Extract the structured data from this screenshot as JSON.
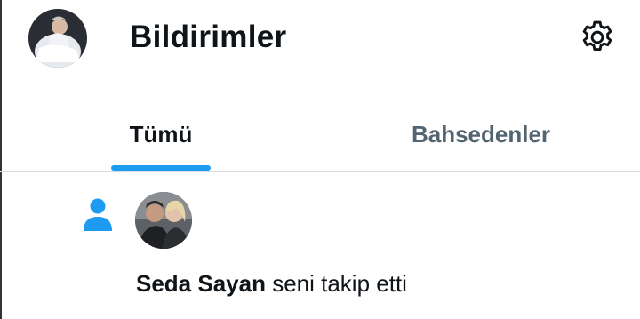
{
  "header": {
    "title": "Bildirimler",
    "avatar_icon": "user-avatar",
    "settings_icon": "gear-icon"
  },
  "tabs": [
    {
      "label": "Tümü",
      "selected": true
    },
    {
      "label": "Bahsedenler",
      "selected": false
    }
  ],
  "notifications": [
    {
      "type_icon": "person-icon",
      "user_name": "Seda Sayan",
      "action_text": " seni takip etti"
    }
  ],
  "colors": {
    "accent": "#1d9bf0",
    "text_primary": "#0f1419",
    "text_secondary": "#536471"
  }
}
